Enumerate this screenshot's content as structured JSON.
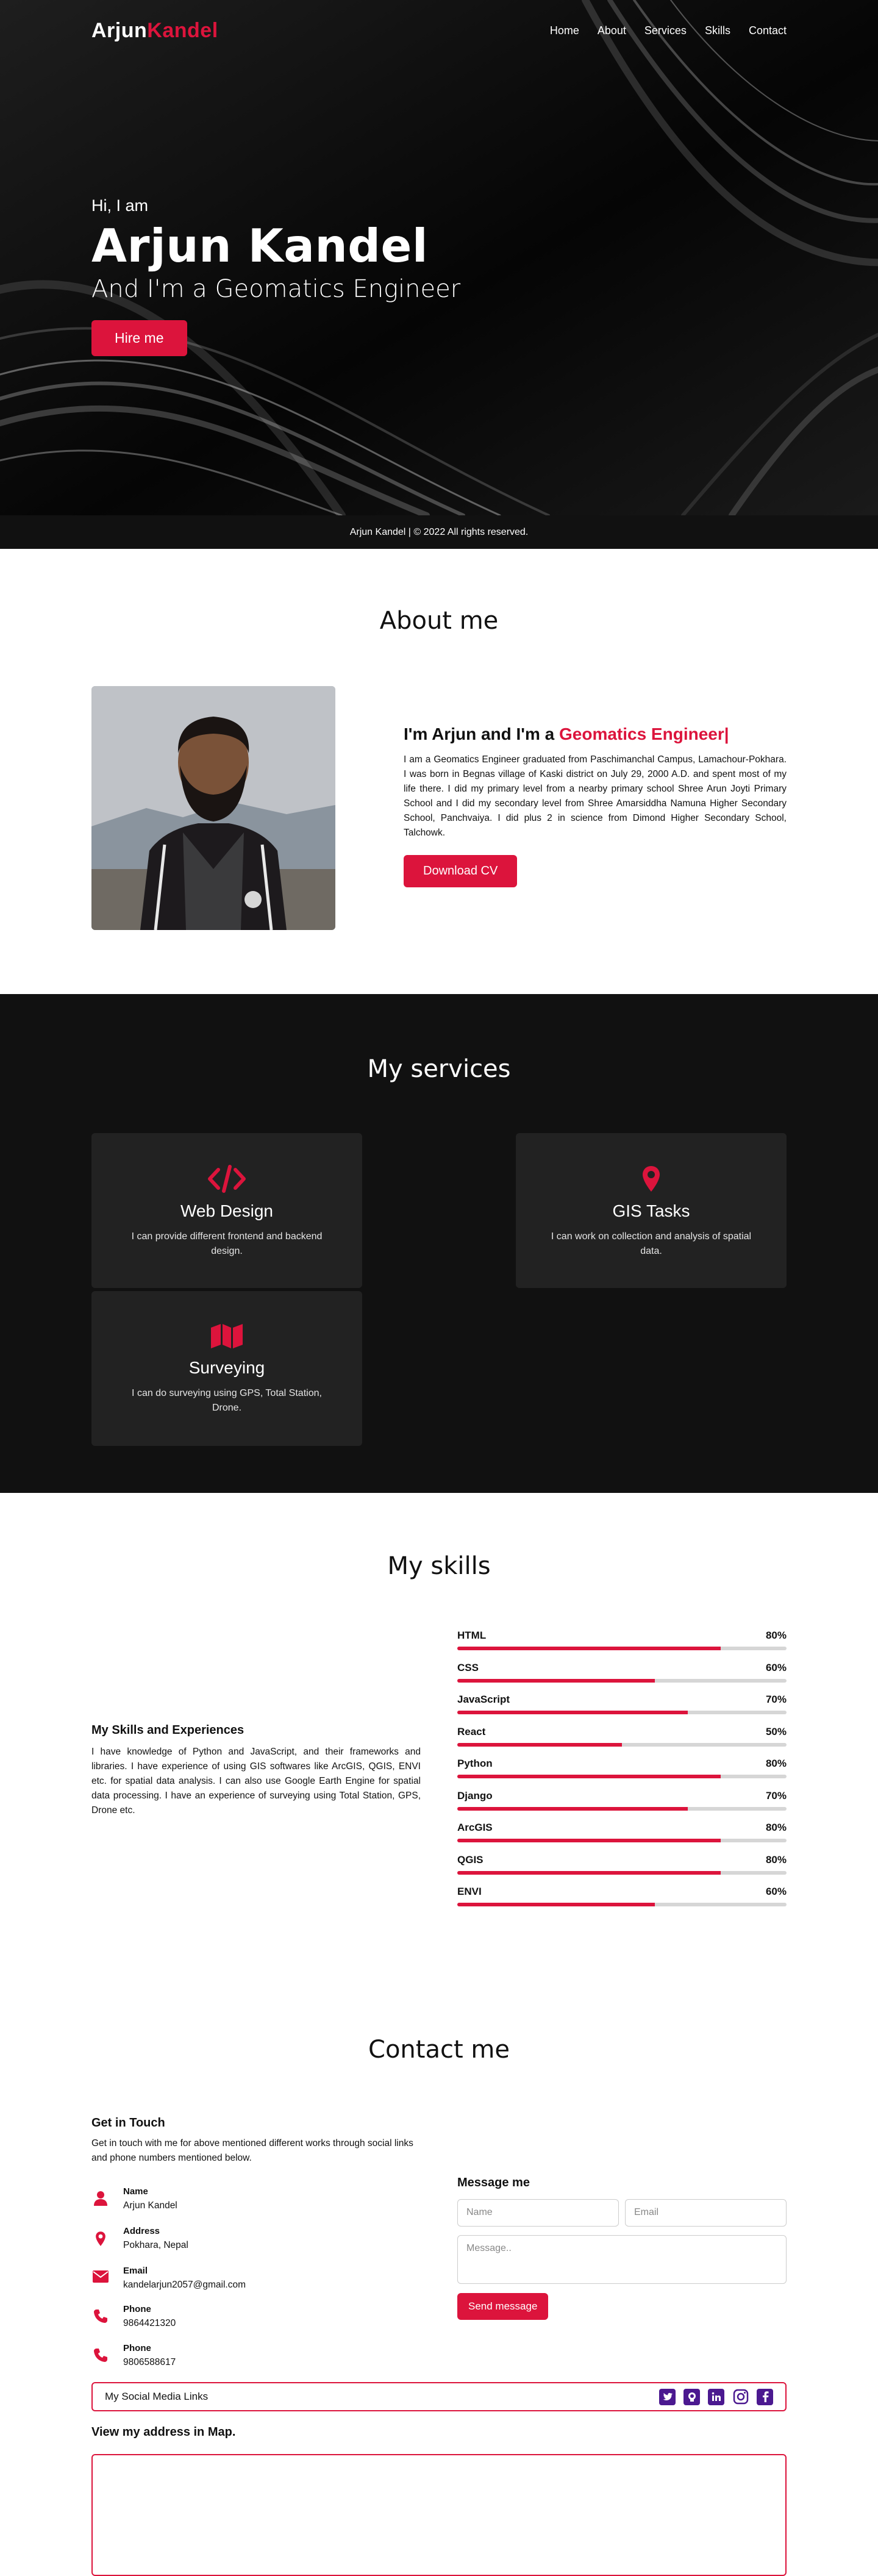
{
  "logo": {
    "first": "Arjun",
    "second": "Kandel"
  },
  "nav": {
    "items": [
      "Home",
      "About",
      "Services",
      "Skills",
      "Contact"
    ]
  },
  "hero": {
    "greeting": "Hi, I am",
    "name": "Arjun Kandel",
    "role": "And I'm a Geomatics Engineer",
    "cta": "Hire me"
  },
  "footer": {
    "text": "Arjun Kandel | © 2022 All rights reserved."
  },
  "about": {
    "title": "About me",
    "heading_plain": "I'm Arjun and I'm a ",
    "heading_accent": "Geomatics Engineer|",
    "paragraph": "I am a Geomatics Engineer graduated from Paschimanchal Campus, Lamachour-Pokhara. I was born in Begnas village of Kaski district on July 29, 2000 A.D. and spent most of my life there. I did my primary level from a nearby primary school Shree Arun Joyti Primary School and I did my secondary level from Shree Amarsiddha Namuna Higher Secondary School, Panchvaiya. I did plus 2 in science from Dimond Higher Secondary School, Talchowk.",
    "cta": "Download CV"
  },
  "services": {
    "title": "My services",
    "cards": [
      {
        "icon": "code-icon",
        "title": "Web Design",
        "desc": "I can provide different frontend and backend design."
      },
      {
        "icon": "location-pin-icon",
        "title": "GIS Tasks",
        "desc": "I can work on collection and analysis of spatial data."
      },
      {
        "icon": "map-icon",
        "title": "Surveying",
        "desc": "I can do surveying using GPS, Total Station, Drone."
      }
    ]
  },
  "skills": {
    "title": "My skills",
    "subtitle": "My Skills and Experiences",
    "paragraph": "I have knowledge of Python and JavaScript, and their frameworks and libraries. I have experience of using GIS softwares like ArcGIS, QGIS, ENVI etc. for spatial data analysis. I can also use Google Earth Engine for spatial data processing. I have an experience of surveying using Total Station, GPS, Drone etc.",
    "items": [
      {
        "name": "HTML",
        "percent": "80%",
        "value": 0.8
      },
      {
        "name": "CSS",
        "percent": "60%",
        "value": 0.6
      },
      {
        "name": "JavaScript",
        "percent": "70%",
        "value": 0.7
      },
      {
        "name": "React",
        "percent": "50%",
        "value": 0.5
      },
      {
        "name": "Python",
        "percent": "80%",
        "value": 0.8
      },
      {
        "name": "Django",
        "percent": "70%",
        "value": 0.7
      },
      {
        "name": "ArcGIS",
        "percent": "80%",
        "value": 0.8
      },
      {
        "name": "QGIS",
        "percent": "80%",
        "value": 0.8
      },
      {
        "name": "ENVI",
        "percent": "60%",
        "value": 0.6
      }
    ]
  },
  "contact": {
    "title": "Contact me",
    "get_in_touch": "Get in Touch",
    "intro": "Get in touch with me for above mentioned different works through social links and phone numbers mentioned below.",
    "info": [
      {
        "icon": "user-icon",
        "label": "Name",
        "value": "Arjun Kandel"
      },
      {
        "icon": "location-pin-icon",
        "label": "Address",
        "value": "Pokhara, Nepal"
      },
      {
        "icon": "envelope-icon",
        "label": "Email",
        "value": "kandelarjun2057@gmail.com"
      },
      {
        "icon": "phone-icon",
        "label": "Phone",
        "value": "9864421320"
      },
      {
        "icon": "phone-icon",
        "label": "Phone",
        "value": "9806588617"
      }
    ],
    "form": {
      "title": "Message me",
      "name_placeholder": "Name",
      "email_placeholder": "Email",
      "message_placeholder": "Message..",
      "submit": "Send message"
    },
    "social_title": "My Social Media Links",
    "social_icons": [
      "twitter-icon",
      "github-icon",
      "linkedin-icon",
      "instagram-icon",
      "facebook-icon"
    ],
    "map_title": "View my address in Map."
  },
  "colors": {
    "accent": "#dc143c",
    "dark": "#111111",
    "card": "#222222",
    "social": "#4b1990"
  }
}
